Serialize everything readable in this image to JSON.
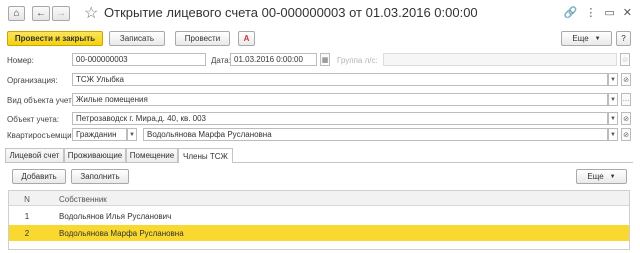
{
  "header": {
    "title": "Открытие лицевого счета 00-000000003 от 01.03.2016 0:00:00"
  },
  "toolbar": {
    "post_close": "Провести и закрыть",
    "save": "Записать",
    "post": "Провести",
    "more": "Еще",
    "help": "?"
  },
  "form": {
    "number": {
      "label": "Номер:",
      "value": "00-000000003"
    },
    "date": {
      "label": "Дата:",
      "value": "01.03.2016  0:00:00"
    },
    "group": {
      "label": "Группа л/с:",
      "value": ""
    },
    "organization": {
      "label": "Организация:",
      "value": "ТСЖ Улыбка"
    },
    "object_kind": {
      "label": "Вид объекта учета:",
      "value": "Жилые помещения"
    },
    "object": {
      "label": "Объект учета:",
      "value": "Петрозаводск г. Мира,д. 40, кв. 003"
    },
    "tenant": {
      "label": "Квартиросъемщик:",
      "type": "Гражданин",
      "value": "Водольянова Марфа Руслановна"
    }
  },
  "tabs": [
    "Лицевой счет",
    "Проживающие",
    "Помещение",
    "Члены ТСЖ"
  ],
  "active_tab": 3,
  "members": {
    "add": "Добавить",
    "fill": "Заполнить",
    "more": "Еще",
    "columns": {
      "n": "N",
      "owner": "Собственник"
    },
    "rows": [
      {
        "n": "1",
        "owner": "Водольянов Илья Русланович"
      },
      {
        "n": "2",
        "owner": "Водольянова Марфа Руслановна"
      }
    ]
  },
  "colors": {
    "accent": "#f4d10e",
    "selected_row": "#f9d930"
  }
}
